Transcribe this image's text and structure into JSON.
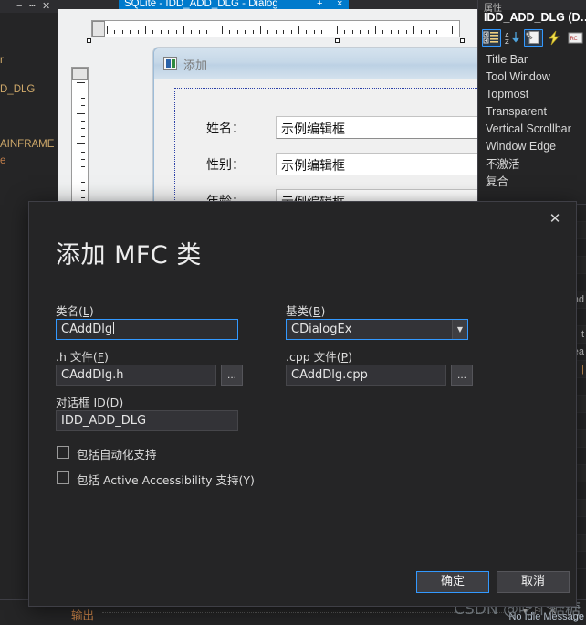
{
  "ide": {
    "designer_tab": {
      "label": "SQLite - IDD_ADD_DLG - Dialog",
      "plus": "+",
      "close": "×"
    },
    "left_panel": {
      "close_icon": "✕",
      "minimize_icon": "−",
      "pin_icon": "┅",
      "fragments": [
        {
          "text": "r"
        },
        {
          "text": "D_DLG"
        },
        {
          "text": "AINFRAME"
        },
        {
          "text": "e"
        }
      ]
    },
    "properties": {
      "panel_tab": "属性",
      "title": "IDD_ADD_DLG (D…",
      "toolbar": [
        {
          "name": "categorized-icon",
          "selected": true
        },
        {
          "name": "alphabetical-sort-icon",
          "selected": false
        },
        {
          "name": "properties-page-icon",
          "selected": true
        },
        {
          "name": "events-lightning-icon",
          "selected": false
        },
        {
          "name": "messages-icon",
          "selected": false
        }
      ],
      "items": [
        "Title Bar",
        "Tool Window",
        "Topmost",
        "Transparent",
        "Vertical Scrollbar",
        "Window Edge",
        "不激活",
        "复合"
      ],
      "grid_values": [
        "nd",
        "t",
        "ea",
        "|"
      ]
    },
    "output": {
      "label": "输出",
      "dropdown_icon": "▾",
      "pin_icon": "⚐",
      "close_icon": "✕",
      "status": "No Idle Message"
    },
    "watermark": "CSDN @吃个糖糖"
  },
  "designer": {
    "mfc_dialog": {
      "title": "添加",
      "app_icon": "app-icon",
      "close_icon": "⌧",
      "rows": [
        {
          "label": "姓名：",
          "value": "示例编辑框"
        },
        {
          "label": "性别：",
          "value": "示例编辑框"
        },
        {
          "label": "年龄：",
          "value": "示例编辑框"
        }
      ]
    }
  },
  "modal": {
    "title": "添加 MFC 类",
    "close_icon": "✕",
    "fields": {
      "class_name": {
        "label_pre": "类名(",
        "label_key": "L",
        "label_post": ")",
        "value": "CAddDlg"
      },
      "base_class": {
        "label_pre": "基类(",
        "label_key": "B",
        "label_post": ")",
        "value": "CDialogEx",
        "arrow": "▼"
      },
      "h_file": {
        "label_pre": ".h 文件(",
        "label_key": "F",
        "label_post": ")",
        "value": "CAddDlg.h",
        "browse": "..."
      },
      "cpp_file": {
        "label_pre": ".cpp 文件(",
        "label_key": "P",
        "label_post": ")",
        "value": "CAddDlg.cpp",
        "browse": "..."
      },
      "dialog_id": {
        "label_pre": "对话框 ID(",
        "label_key": "D",
        "label_post": ")",
        "value": "IDD_ADD_DLG"
      }
    },
    "checkboxes": [
      {
        "label": "包括自动化支持",
        "checked": false
      },
      {
        "label": "包括 Active Accessibility 支持(Y)",
        "checked": false
      }
    ],
    "buttons": {
      "ok": "确定",
      "cancel": "取消"
    }
  },
  "colors": {
    "accent": "#3399ff",
    "modal_bg": "#252526",
    "ide_bg": "#1e1e1e",
    "tab_active": "#007acc",
    "designer_bg": "#eff0f1"
  }
}
